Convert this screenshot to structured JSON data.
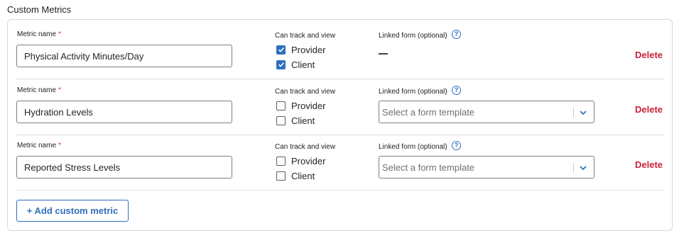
{
  "section": {
    "title": "Custom Metrics"
  },
  "labels": {
    "metric_name": "Metric name",
    "required_mark": "*",
    "can_track": "Can track and view",
    "linked_form": "Linked form (optional)",
    "help": "?",
    "delete": "Delete"
  },
  "metrics": [
    {
      "name": "Physical Activity Minutes/Day",
      "provider": {
        "label": "Provider",
        "checked": true
      },
      "client": {
        "label": "Client",
        "checked": true
      },
      "linked_form": {
        "mode": "none",
        "value": "—"
      }
    },
    {
      "name": "Hydration Levels",
      "provider": {
        "label": "Provider",
        "checked": false
      },
      "client": {
        "label": "Client",
        "checked": false
      },
      "linked_form": {
        "mode": "select",
        "placeholder": "Select a form template"
      }
    },
    {
      "name": "Reported Stress Levels",
      "provider": {
        "label": "Provider",
        "checked": false
      },
      "client": {
        "label": "Client",
        "checked": false
      },
      "linked_form": {
        "mode": "select",
        "placeholder": "Select a form template"
      }
    }
  ],
  "add_button": {
    "label": "+ Add custom metric"
  },
  "colors": {
    "accent": "#2f6fbd",
    "danger": "#c8233b",
    "required": "#d0263c",
    "border": "#d4d7dc"
  },
  "icons": {
    "help": "help-circle-icon",
    "check": "checkmark-icon",
    "chevron": "chevron-down-icon"
  }
}
